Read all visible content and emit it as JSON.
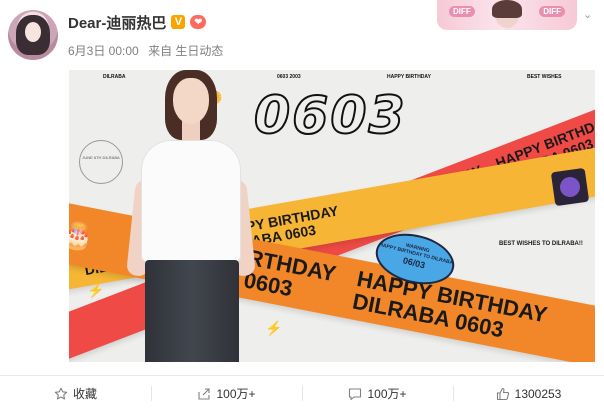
{
  "post": {
    "author": "Dear-迪丽热巴",
    "verified_badge": "V",
    "date": "6月3日 00:00",
    "source": "来自 生日动态"
  },
  "decor": {
    "left_tag": "DIFF",
    "right_tag": "DIFF"
  },
  "image": {
    "top_labels": [
      "DILRABA",
      "0603 2003",
      "HAPPY BIRTHDAY",
      "BEST WISHES"
    ],
    "big_number": "0603",
    "band_line1": "HAPPY BIRTHDAY",
    "band_line2": "DILRABA 0603",
    "sticker_top": "WARNING",
    "sticker_mid": "HAPPY BIRTHDAY TO DILRABA",
    "sticker_num": "06/03",
    "wishes": "BEST WISHES TO DILRABA!!",
    "circle_note": "JUNE 6TH DILRABA"
  },
  "actions": {
    "favorite": "收藏",
    "forward": "100万+",
    "comment": "100万+",
    "like": "1300253"
  },
  "colors": {
    "band_yellow": "#f6b535",
    "band_red": "#ef4a45",
    "band_orange": "#f2872a",
    "verified": "#f7a500"
  }
}
